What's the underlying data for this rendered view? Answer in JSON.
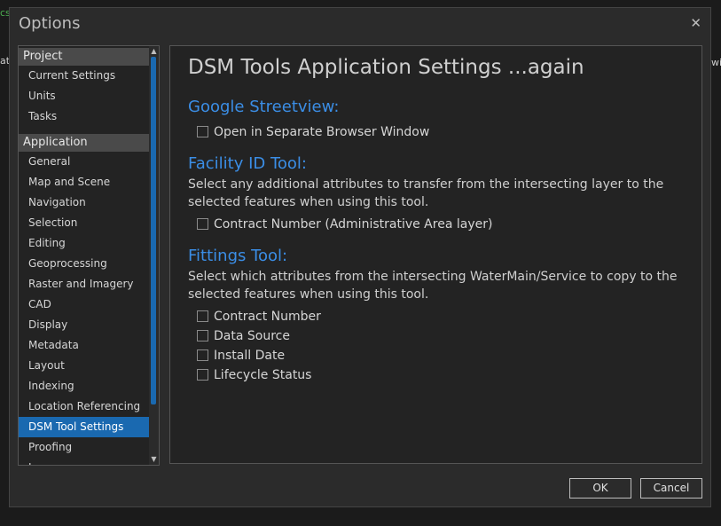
{
  "background": {
    "left_fragment_top": "cs",
    "left_fragment_mid": "ate",
    "right_fragment": "wil"
  },
  "window": {
    "title": "Options",
    "close_glyph": "✕"
  },
  "sidebar": {
    "sections": [
      {
        "label": "Project",
        "items": [
          "Current Settings",
          "Units",
          "Tasks"
        ]
      },
      {
        "label": "Application",
        "items": [
          "General",
          "Map and Scene",
          "Navigation",
          "Selection",
          "Editing",
          "Geoprocessing",
          "Raster and Imagery",
          "CAD",
          "Display",
          "Metadata",
          "Layout",
          "Indexing",
          "Location Referencing",
          "DSM Tool Settings",
          "Proofing",
          "L..."
        ]
      }
    ],
    "selected": "DSM Tool Settings",
    "scroll_up_glyph": "▲",
    "scroll_down_glyph": "▼"
  },
  "content": {
    "heading": "DSM Tools Application Settings ...again",
    "streetview": {
      "title": "Google Streetview:",
      "option": "Open in Separate Browser Window"
    },
    "facility": {
      "title": "Facility ID Tool:",
      "description": "Select any additional attributes to transfer from the intersecting layer to the selected features when using this tool.",
      "option": "Contract Number (Administrative Area layer)"
    },
    "fittings": {
      "title": "Fittings Tool:",
      "description": "Select which attributes from the intersecting WaterMain/Service to copy to the selected features when using this tool.",
      "options": [
        "Contract Number",
        "Data Source",
        "Install Date",
        "Lifecycle Status"
      ]
    }
  },
  "buttons": {
    "ok": "OK",
    "cancel": "Cancel"
  },
  "colors": {
    "accent": "#1a69b0",
    "section_title": "#3b8ee6",
    "background": "#2b2b2b"
  },
  "icons": {
    "close": "close-icon",
    "checkbox": "checkbox-unchecked"
  }
}
